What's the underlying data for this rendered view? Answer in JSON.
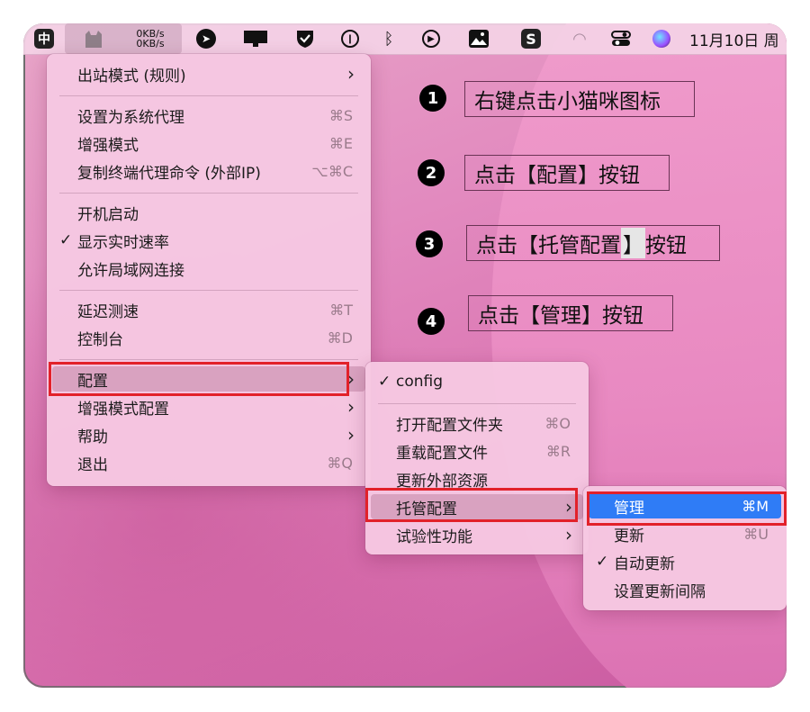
{
  "menubar": {
    "input_method": "中",
    "clash_upload": "0KB/s",
    "clash_download": "0KB/s",
    "clock": "11月10日 周"
  },
  "main_menu": [
    {
      "label": "出站模式 (规则)",
      "submenu": true
    },
    {
      "separator": true
    },
    {
      "label": "设置为系统代理",
      "shortcut": "⌘S"
    },
    {
      "label": "增强模式",
      "shortcut": "⌘E"
    },
    {
      "label": "复制终端代理命令 (外部IP)",
      "shortcut": "⌥⌘C"
    },
    {
      "separator": true
    },
    {
      "label": "开机启动"
    },
    {
      "label": "显示实时速率",
      "checked": true
    },
    {
      "label": "允许局域网连接"
    },
    {
      "separator": true
    },
    {
      "label": "延迟测速",
      "shortcut": "⌘T"
    },
    {
      "label": "控制台",
      "shortcut": "⌘D"
    },
    {
      "separator": true
    },
    {
      "label": "配置",
      "submenu": true,
      "highlighted": true
    },
    {
      "label": "增强模式配置",
      "submenu": true
    },
    {
      "label": "帮助",
      "submenu": true
    },
    {
      "label": "退出",
      "shortcut": "⌘Q"
    }
  ],
  "config_menu": [
    {
      "label": "config",
      "checked": true
    },
    {
      "separator": true
    },
    {
      "label": "打开配置文件夹",
      "shortcut": "⌘O"
    },
    {
      "label": "重载配置文件",
      "shortcut": "⌘R"
    },
    {
      "label": "更新外部资源"
    },
    {
      "label": "托管配置",
      "submenu": true,
      "highlighted": true
    },
    {
      "label": "试验性功能",
      "submenu": true
    }
  ],
  "managed_menu": [
    {
      "label": "管理",
      "shortcut": "⌘M",
      "selected": true
    },
    {
      "label": "更新",
      "shortcut": "⌘U"
    },
    {
      "label": "自动更新",
      "checked": true
    },
    {
      "label": "设置更新间隔"
    }
  ],
  "annotations": [
    {
      "number": "1",
      "text": "右键点击小猫咪图标"
    },
    {
      "number": "2",
      "text": "点击【配置】按钮"
    },
    {
      "number": "3",
      "text_main": "点击【托管配置",
      "text_highlight": "】",
      "text_tail": "按钮"
    },
    {
      "number": "4",
      "text": "点击【管理】按钮"
    }
  ],
  "colors": {
    "selection_blue": "#2f7cf6",
    "annotation_red": "#e2212a"
  }
}
